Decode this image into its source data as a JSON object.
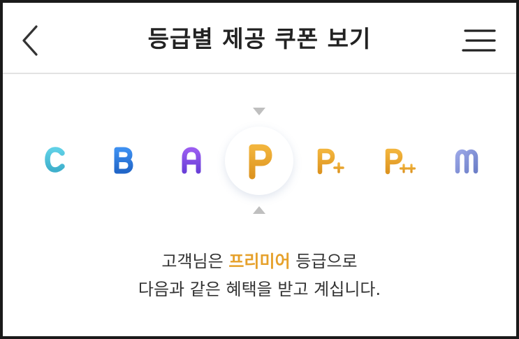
{
  "header": {
    "title": "등급별 제공 쿠폰 보기"
  },
  "grades": {
    "items": [
      {
        "letter": "C",
        "suffix": "",
        "color": "#4cc3dc",
        "selected": false
      },
      {
        "letter": "B",
        "suffix": "",
        "color": "#2d7de0",
        "selected": false
      },
      {
        "letter": "A",
        "suffix": "",
        "color": "#7d4fe0",
        "selected": false
      },
      {
        "letter": "P",
        "suffix": "",
        "color": "#e6a12b",
        "selected": true
      },
      {
        "letter": "P",
        "suffix": "+",
        "color": "#e6a12b",
        "selected": false
      },
      {
        "letter": "P",
        "suffix": "++",
        "color": "#e6a12b",
        "selected": false
      },
      {
        "letter": "m",
        "suffix": "",
        "color": "#8a97d8",
        "selected": false
      }
    ]
  },
  "message": {
    "line1_prefix": "고객님은 ",
    "line1_highlight": "프리미어",
    "line1_suffix": " 등급으로",
    "line2": "다음과 같은 혜택을 받고 계십니다."
  },
  "colors": {
    "accent": "#e6a12b",
    "text": "#333333",
    "divider": "#e2e2e2"
  },
  "icons": {
    "back": "chevron-left-icon",
    "menu": "hamburger-menu-icon",
    "selector_top": "triangle-down-icon",
    "selector_bottom": "triangle-up-icon"
  }
}
